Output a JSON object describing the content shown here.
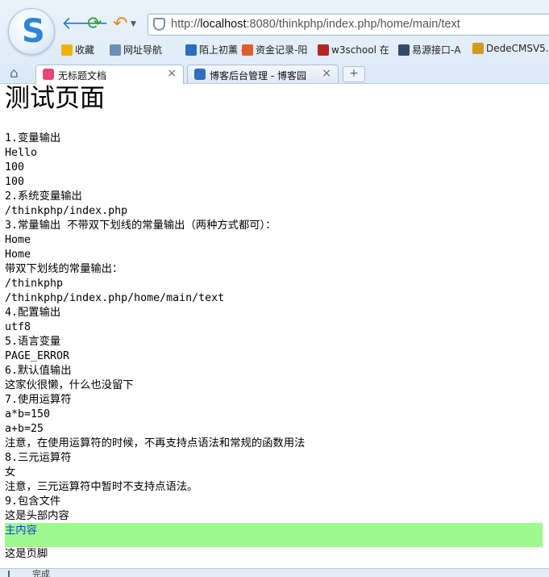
{
  "browser": {
    "address": {
      "prefix": "http://",
      "host": "localhost",
      "rest": ":8080/thinkphp/index.php/home/main/text"
    },
    "bookmarks": [
      {
        "label": "收藏",
        "icon": "star-icon",
        "color": "#f0b400"
      },
      {
        "label": "网址导航",
        "icon": "globe-icon",
        "color": "#6a8fb8"
      },
      {
        "label": "陌上初薰 -",
        "icon": "blog-icon",
        "color": "#2a6fbf"
      },
      {
        "label": "资金记录-阳",
        "icon": "sun-icon",
        "color": "#e35c2a"
      },
      {
        "label": "w3school 在",
        "icon": "w3-icon",
        "color": "#b8241f"
      },
      {
        "label": "易源接口-A",
        "icon": "api-icon",
        "color": "#334a6a"
      },
      {
        "label": "DedeCMSV5.",
        "icon": "dede-icon",
        "color": "#d49a1f"
      }
    ],
    "tabs": [
      {
        "label": "无标题文档",
        "active": true
      },
      {
        "label": "博客后台管理 - 博客园",
        "active": false
      }
    ],
    "new_tab": "+",
    "status": "完成"
  },
  "page": {
    "title": "测试页面",
    "lines": [
      "1.变量输出",
      "Hello",
      "100",
      "100",
      "2.系统变量输出",
      "/thinkphp/index.php",
      "3.常量输出 不带双下划线的常量输出（两种方式都可）：",
      "Home",
      "Home",
      "带双下划线的常量输出：",
      "/thinkphp",
      "/thinkphp/index.php/home/main/text",
      "4.配置输出",
      "utf8",
      "5.语言变量",
      "PAGE_ERROR",
      "6.默认值输出",
      "这家伙很懒，什么也没留下",
      "7.使用运算符",
      "a*b=150",
      "a+b=25",
      "注意，在使用运算符的时候，不再支持点语法和常规的函数用法",
      "8.三元运算符",
      "女",
      "注意，三元运算符中暂时不支持点语法。",
      "9.包含文件",
      "这是头部内容"
    ],
    "main_content": "主内容",
    "footer": "这是页脚",
    "main_bg": "#9ffa8e"
  }
}
